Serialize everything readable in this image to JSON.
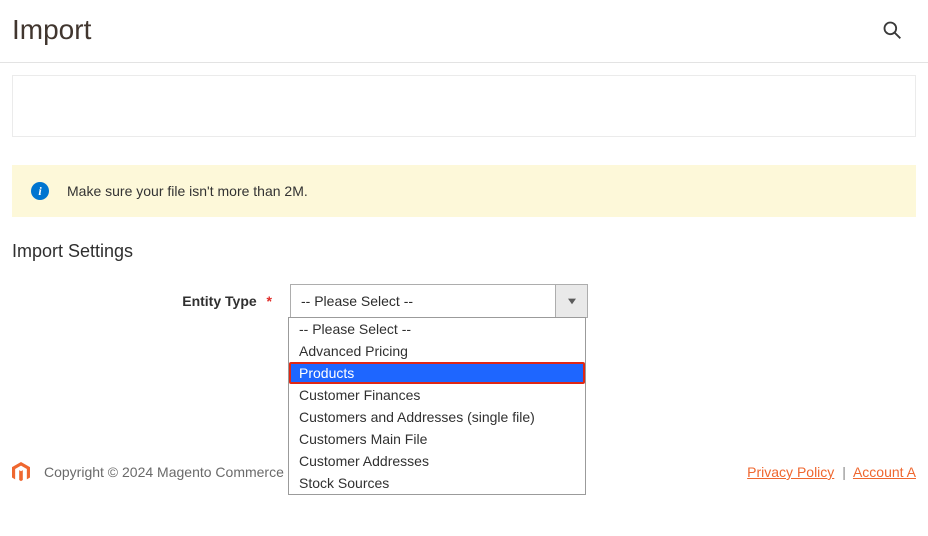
{
  "header": {
    "title": "Import"
  },
  "notice": {
    "text": "Make sure your file isn't more than 2M."
  },
  "settings": {
    "title": "Import Settings",
    "entity_label": "Entity Type",
    "entity_selected": "-- Please Select --",
    "dropdown": {
      "items": [
        "-- Please Select --",
        "Advanced Pricing",
        "Products",
        "Customer Finances",
        "Customers and Addresses (single file)",
        "Customers Main File",
        "Customer Addresses",
        "Stock Sources"
      ],
      "selected_index": 2
    }
  },
  "footer": {
    "copyright": "Copyright © 2024 Magento Commerce",
    "privacy": "Privacy Policy",
    "account": "Account A"
  }
}
